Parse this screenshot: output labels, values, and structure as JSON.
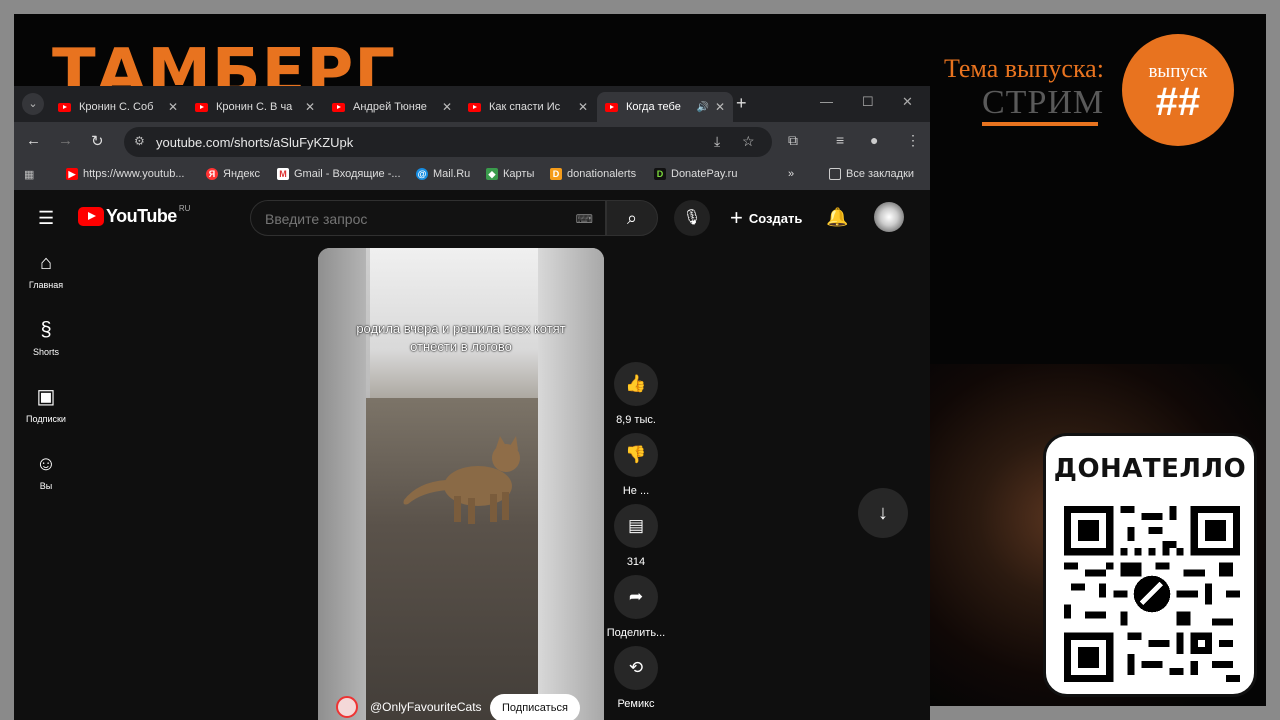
{
  "overlay": {
    "title": "ТАМБЕРГ",
    "theme_label": "Тема выпуска:",
    "theme_value": "СТРИМ",
    "episode_label": "выпуск",
    "episode_number": "##",
    "donate_title": "ДОНАТЕЛЛО",
    "accent_color": "#e8731f"
  },
  "browser": {
    "tabs": [
      {
        "title": "Кронин С. Соб",
        "active": false
      },
      {
        "title": "Кронин С. В ча",
        "active": false
      },
      {
        "title": "Андрей Тюняе",
        "active": false
      },
      {
        "title": "Как спасти Ис",
        "active": false
      },
      {
        "title": "Когда тебе",
        "active": true
      }
    ],
    "url": "youtube.com/shorts/aSluFyKZUpk",
    "bookmarks": [
      {
        "label": "https://www.youtub...",
        "icon": "youtube-icon"
      },
      {
        "label": "Яндекс",
        "icon": "yandex-icon"
      },
      {
        "label": "Gmail - Входящие -...",
        "icon": "gmail-icon"
      },
      {
        "label": "Mail.Ru",
        "icon": "mailru-icon"
      },
      {
        "label": "Карты",
        "icon": "maps-icon"
      },
      {
        "label": "donationalerts",
        "icon": "donationalerts-icon"
      },
      {
        "label": "DonatePay.ru",
        "icon": "donatepay-icon"
      }
    ],
    "all_bookmarks": "Все закладки"
  },
  "youtube": {
    "logo_text": "YouTube",
    "region": "RU",
    "search_placeholder": "Введите запрос",
    "create_label": "Создать",
    "nav": [
      {
        "label": "Главная",
        "icon": "home-icon"
      },
      {
        "label": "Shorts",
        "icon": "shorts-icon"
      },
      {
        "label": "Подписки",
        "icon": "subscriptions-icon"
      },
      {
        "label": "Вы",
        "icon": "you-icon"
      }
    ],
    "short": {
      "caption": "родила вчера и решила всех котят отнести в логово",
      "channel": "@OnlyFavouriteCats",
      "subscribe_label": "Подписаться"
    },
    "actions": {
      "likes": "8,9 тыс.",
      "dislike": "Не ...",
      "comments": "314",
      "share": "Поделить...",
      "remix": "Ремикс"
    }
  }
}
